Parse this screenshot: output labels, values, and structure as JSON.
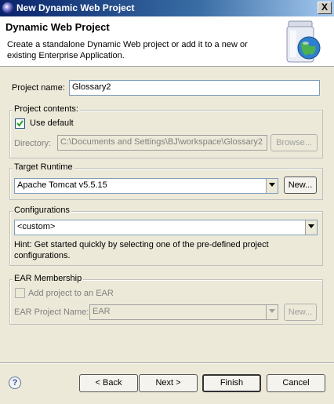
{
  "window": {
    "title": "New Dynamic Web Project",
    "close_glyph": "X"
  },
  "header": {
    "title": "Dynamic Web Project",
    "description": "Create a standalone Dynamic Web project or add it to a new or existing Enterprise Application."
  },
  "project_name": {
    "label": "Project name:",
    "value": "Glossary2"
  },
  "project_contents": {
    "group_label": "Project contents:",
    "use_default_label": "Use default",
    "use_default_checked": true,
    "directory_label": "Directory:",
    "directory_value": "C:\\Documents and Settings\\BJ\\workspace\\Glossary2",
    "browse_label": "Browse..."
  },
  "target_runtime": {
    "group_label": "Target Runtime",
    "value": "Apache Tomcat v5.5.15",
    "new_label": "New..."
  },
  "configurations": {
    "group_label": "Configurations",
    "value": "<custom>",
    "hint": "Hint: Get started quickly by selecting one of the pre-defined project configurations."
  },
  "ear_membership": {
    "group_label": "EAR Membership",
    "add_label": "Add project to an EAR",
    "add_checked": false,
    "ear_name_label": "EAR Project Name:",
    "ear_name_value": "EAR",
    "new_label": "New..."
  },
  "footer": {
    "help_glyph": "?",
    "back_label": "< Back",
    "next_label": "Next >",
    "finish_label": "Finish",
    "cancel_label": "Cancel"
  }
}
